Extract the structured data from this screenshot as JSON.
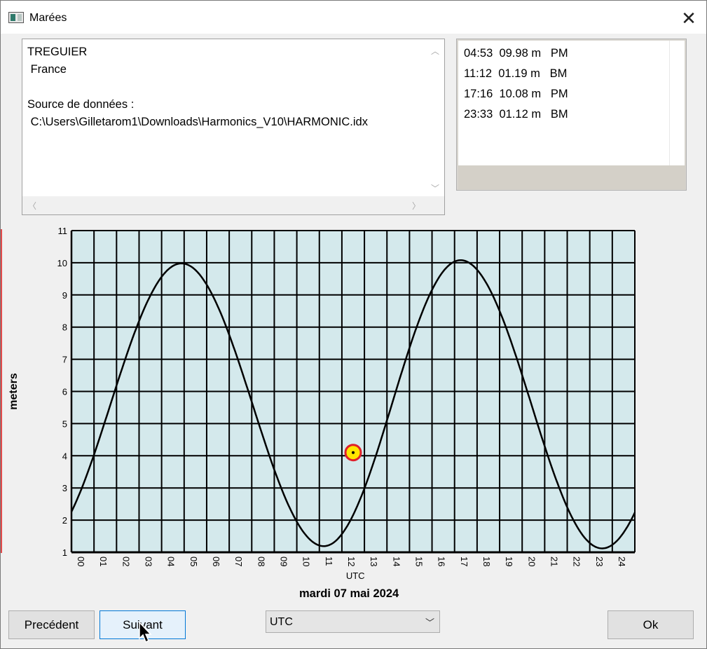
{
  "window": {
    "title": "Marées",
    "close_glyph": "✕"
  },
  "info": {
    "lines": [
      "TREGUIER",
      " France",
      "",
      "Source de données :",
      " C:\\Users\\Gilletarom1\\Downloads\\Harmonics_V10\\HARMONIC.idx"
    ]
  },
  "tides": [
    "04:53  09.98 m   PM",
    "11:12  01.19 m   BM",
    "17:16  10.08 m   PM",
    "23:33  01.12 m   BM"
  ],
  "chart_data": {
    "type": "line",
    "ylabel": "meters",
    "xlabel": "UTC",
    "x_ticks": [
      "00",
      "01",
      "02",
      "03",
      "04",
      "05",
      "06",
      "07",
      "08",
      "09",
      "10",
      "11",
      "12",
      "13",
      "14",
      "15",
      "16",
      "17",
      "18",
      "19",
      "20",
      "21",
      "22",
      "23",
      "24"
    ],
    "y_ticks": [
      1,
      2,
      3,
      4,
      5,
      6,
      7,
      8,
      9,
      10,
      11
    ],
    "xlim": [
      0,
      25
    ],
    "ylim": [
      1,
      11
    ],
    "grid": true,
    "extrema": [
      {
        "t": "04:53",
        "h": 9.98
      },
      {
        "t": "11:12",
        "h": 1.19
      },
      {
        "t": "17:16",
        "h": 10.08
      },
      {
        "t": "23:33",
        "h": 1.12
      }
    ],
    "current_marker": {
      "x": 12.5,
      "y": 4.1
    },
    "colors": {
      "background": "#d4e9ec",
      "grid": "#000000",
      "curve": "#000000",
      "marker_fill": "#ffe600",
      "marker_ring": "#e0202a"
    }
  },
  "date": "mardi 07 mai 2024",
  "buttons": {
    "previous": "Precédent",
    "next": "Suivant",
    "ok": "Ok"
  },
  "timezone_select": {
    "value": "UTC"
  }
}
